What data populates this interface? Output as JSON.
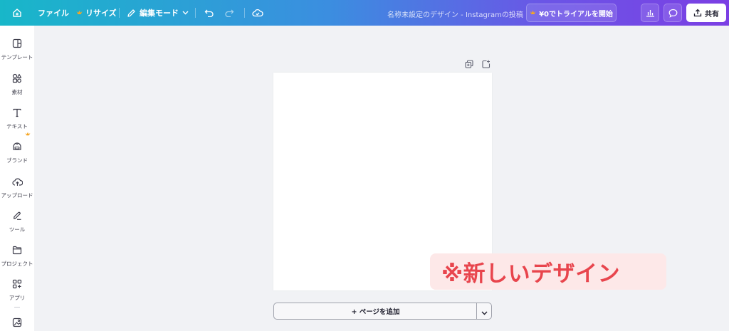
{
  "topbar": {
    "file_label": "ファイル",
    "resize_label": "リサイズ",
    "edit_mode_label": "編集モード",
    "doc_title": "名称未設定のデザイン - Instagramの投稿",
    "trial_label": "¥0でトライアルを開始",
    "share_label": "共有"
  },
  "sidebar": {
    "items": [
      {
        "label": "テンプレート"
      },
      {
        "label": "素材"
      },
      {
        "label": "テキスト"
      },
      {
        "label": "ブランド"
      },
      {
        "label": "アップロード"
      },
      {
        "label": "ツール"
      },
      {
        "label": "プロジェクト"
      },
      {
        "label": "アプリ"
      }
    ]
  },
  "canvas": {
    "add_page_label": "+ ページを追加"
  },
  "annotation": {
    "text": "※新しいデザイン"
  },
  "colors": {
    "accent_gradient_start": "#18b7c9",
    "accent_gradient_end": "#7b3fe4",
    "annotation_text": "#e8454d",
    "annotation_bg": "#fde8e8",
    "crown": "#f5a623"
  },
  "icons": [
    "home-icon",
    "crown-icon",
    "pencil-icon",
    "chevron-down-icon",
    "undo-icon",
    "redo-icon",
    "cloud-check-icon",
    "chart-icon",
    "comment-icon",
    "share-icon",
    "template-icon",
    "elements-icon",
    "text-icon",
    "brand-icon",
    "upload-icon",
    "tools-icon",
    "folder-icon",
    "apps-icon",
    "photo-icon",
    "duplicate-page-icon",
    "add-page-icon"
  ]
}
